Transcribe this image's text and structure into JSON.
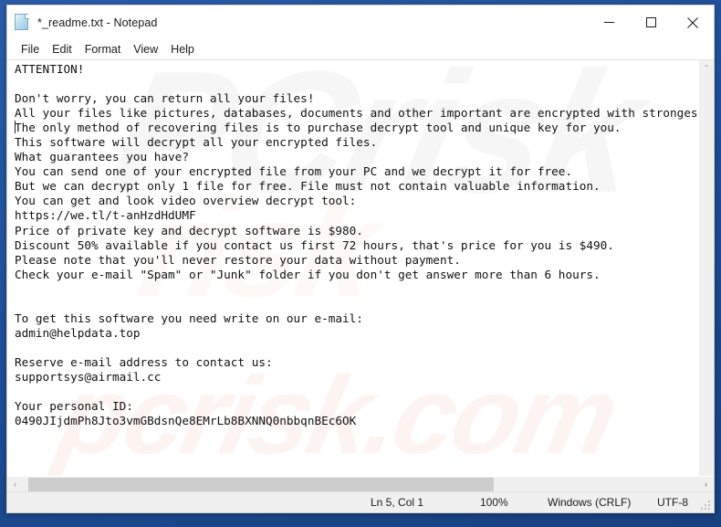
{
  "window": {
    "title": "*_readme.txt - Notepad",
    "icon": "document-icon",
    "caption_buttons": [
      {
        "name": "minimize",
        "label": "Minimize"
      },
      {
        "name": "maximize",
        "label": "Maximize"
      },
      {
        "name": "close",
        "label": "Close"
      }
    ]
  },
  "menubar": {
    "items": [
      {
        "label": "File"
      },
      {
        "label": "Edit"
      },
      {
        "label": "Format"
      },
      {
        "label": "View"
      },
      {
        "label": "Help"
      }
    ]
  },
  "document": {
    "filename": "*_readme.txt",
    "text": "ATTENTION!\n\nDon't worry, you can return all your files!\nAll your files like pictures, databases, documents and other important are encrypted with strongest encryption and unique key.\nThe only method of recovering files is to purchase decrypt tool and unique key for you.\nThis software will decrypt all your encrypted files.\nWhat guarantees you have?\nYou can send one of your encrypted file from your PC and we decrypt it for free.\nBut we can decrypt only 1 file for free. File must not contain valuable information.\nYou can get and look video overview decrypt tool:\nhttps://we.tl/t-anHzdHdUMF\nPrice of private key and decrypt software is $980.\nDiscount 50% available if you contact us first 72 hours, that's price for you is $490.\nPlease note that you'll never restore your data without payment.\nCheck your e-mail \"Spam\" or \"Junk\" folder if you don't get answer more than 6 hours.\n\n\nTo get this software you need write on our e-mail:\nadmin@helpdata.top\n\nReserve e-mail address to contact us:\nsupportsys@airmail.cc\n\nYour personal ID:\n0490JIjdmPh8Jto3vmGBdsnQe8EMrLb8BXNNQ0nbbqnBEc6OK",
    "video_url": "https://we.tl/t-anHzdHdUMF",
    "price_full": "$980",
    "price_discount": "$490",
    "discount_percent": "50%",
    "discount_window_hours": "72 hours",
    "answer_window_hours": "6 hours",
    "email_primary": "admin@helpdata.top",
    "email_reserve": "supportsys@airmail.cc",
    "personal_id": "0490JIjdmPh8Jto3vmGBdsnQe8EMrLb8BXNNQ0nbbqnBEc6OK"
  },
  "watermark": {
    "gray_text": "PCrisk",
    "pink_text": "pcrisk.com",
    "pink_text2": "risk"
  },
  "scrollbars": {
    "vertical": {
      "up_glyph": "⌃",
      "down_glyph": "⌄"
    },
    "horizontal": {
      "left_glyph": "‹",
      "right_glyph": "›"
    }
  },
  "statusbar": {
    "cursor_position": "Ln 5, Col 1",
    "zoom": "100%",
    "line_ending": "Windows (CRLF)",
    "encoding": "UTF-8"
  },
  "colors": {
    "desktop": "#1f4e96",
    "window_bg": "#ffffff",
    "chrome": "#f0f0f0",
    "text": "#111111",
    "scroll_thumb": "#cdcdcd"
  }
}
